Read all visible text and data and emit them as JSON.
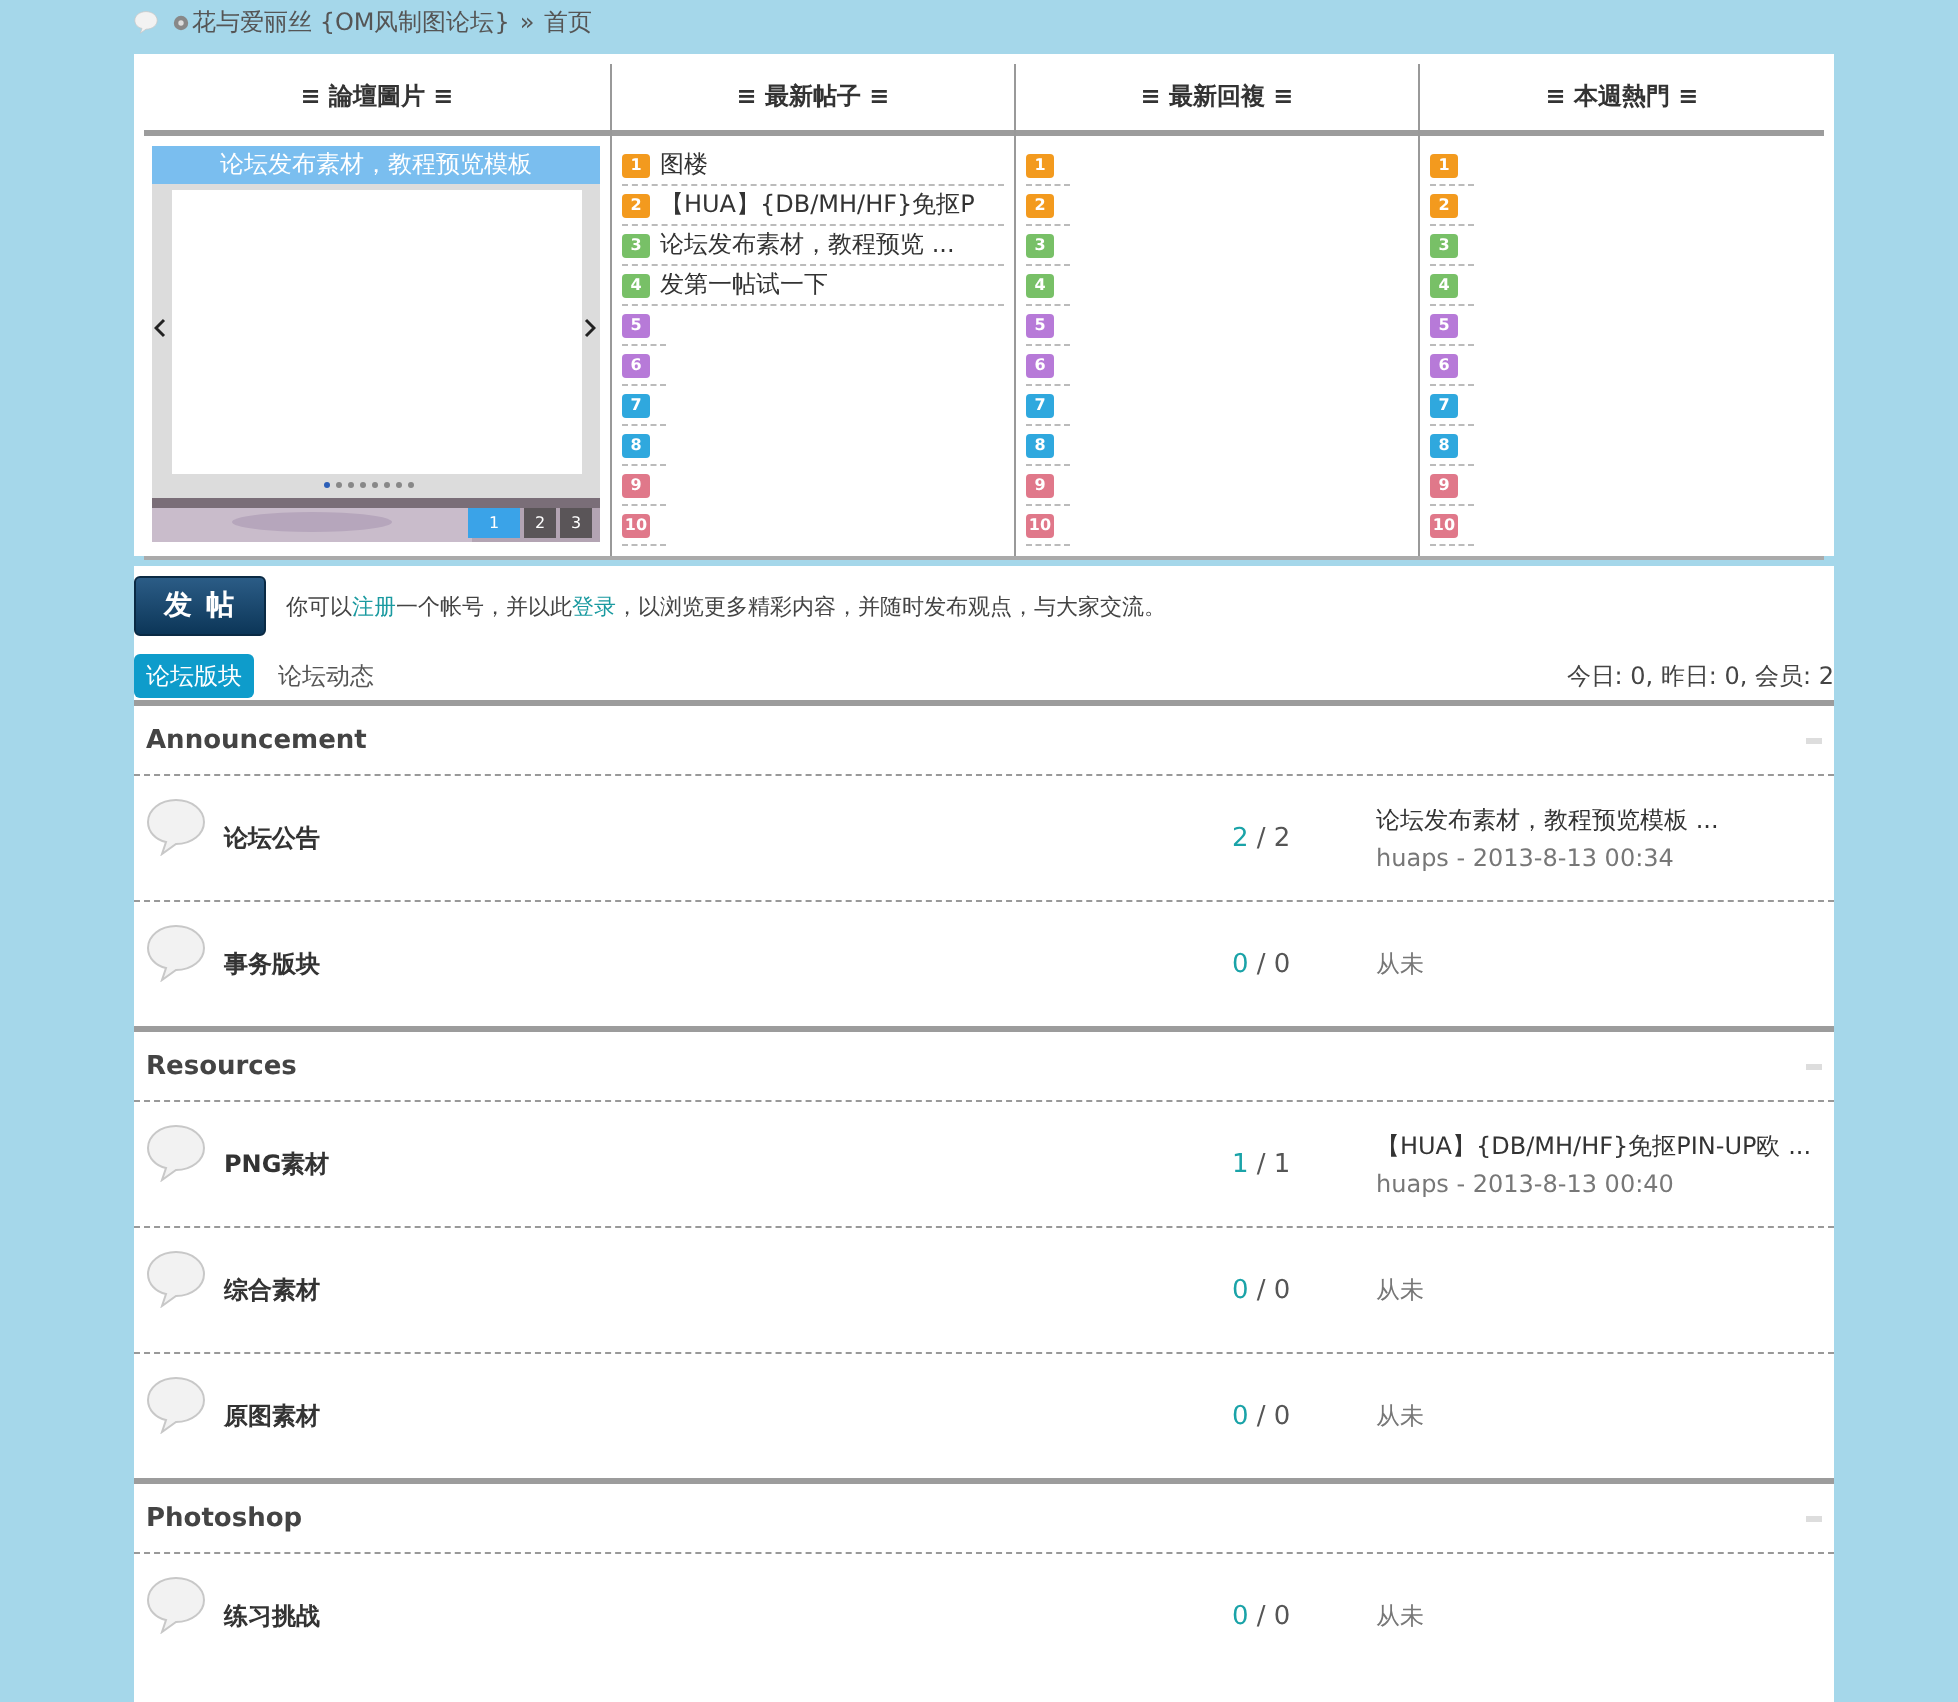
{
  "breadcrumb": {
    "site": "花与爱丽丝 {OM风制图论坛}",
    "separator": "»",
    "current": "首页"
  },
  "portal": {
    "columns": [
      {
        "kind": "slideshow",
        "header": "≡ 論壇圖片 ≡",
        "caption": "论坛发布素材，教程预览模板",
        "dots": [
          {
            "selected": true
          },
          {
            "selected": false
          },
          {
            "selected": false
          },
          {
            "selected": false
          },
          {
            "selected": false
          },
          {
            "selected": false
          },
          {
            "selected": false
          },
          {
            "selected": false
          }
        ],
        "pages": [
          {
            "label": "1",
            "selected": true
          },
          {
            "label": "2",
            "selected": false
          },
          {
            "label": "3",
            "selected": false
          }
        ]
      },
      {
        "kind": "list",
        "header": "≡ 最新帖子 ≡",
        "items": [
          {
            "rank": "1",
            "color": "#f39a1e",
            "title": "图楼"
          },
          {
            "rank": "2",
            "color": "#f39a1e",
            "title": "【HUA】{DB/MH/HF}免抠P"
          },
          {
            "rank": "3",
            "color": "#78c067",
            "title": "论坛发布素材，教程预览 ..."
          },
          {
            "rank": "4",
            "color": "#78c067",
            "title": "发第一帖试一下"
          },
          {
            "rank": "5",
            "color": "#b77ad8"
          },
          {
            "rank": "6",
            "color": "#b77ad8"
          },
          {
            "rank": "7",
            "color": "#2fa8de"
          },
          {
            "rank": "8",
            "color": "#2fa8de"
          },
          {
            "rank": "9",
            "color": "#e0788a"
          },
          {
            "rank": "10",
            "color": "#e0788a"
          }
        ]
      },
      {
        "kind": "list",
        "header": "≡ 最新回複 ≡",
        "items": [
          {
            "rank": "1",
            "color": "#f39a1e"
          },
          {
            "rank": "2",
            "color": "#f39a1e"
          },
          {
            "rank": "3",
            "color": "#78c067"
          },
          {
            "rank": "4",
            "color": "#78c067"
          },
          {
            "rank": "5",
            "color": "#b77ad8"
          },
          {
            "rank": "6",
            "color": "#b77ad8"
          },
          {
            "rank": "7",
            "color": "#2fa8de"
          },
          {
            "rank": "8",
            "color": "#2fa8de"
          },
          {
            "rank": "9",
            "color": "#e0788a"
          },
          {
            "rank": "10",
            "color": "#e0788a"
          }
        ]
      },
      {
        "kind": "list",
        "header": "≡ 本週熱門 ≡",
        "items": [
          {
            "rank": "1",
            "color": "#f39a1e"
          },
          {
            "rank": "2",
            "color": "#f39a1e"
          },
          {
            "rank": "3",
            "color": "#78c067"
          },
          {
            "rank": "4",
            "color": "#78c067"
          },
          {
            "rank": "5",
            "color": "#b77ad8"
          },
          {
            "rank": "6",
            "color": "#b77ad8"
          },
          {
            "rank": "7",
            "color": "#2fa8de"
          },
          {
            "rank": "8",
            "color": "#2fa8de"
          },
          {
            "rank": "9",
            "color": "#e0788a"
          },
          {
            "rank": "10",
            "color": "#e0788a"
          }
        ]
      }
    ]
  },
  "post_button": "发 帖",
  "notice": [
    {
      "kind": "text",
      "text": "你可以"
    },
    {
      "kind": "link",
      "text": "注册"
    },
    {
      "kind": "text",
      "text": "一个帐号，并以此"
    },
    {
      "kind": "link",
      "text": "登录"
    },
    {
      "kind": "text",
      "text": "，以浏览更多精彩内容，并随时发布观点，与大家交流。"
    }
  ],
  "tabs": [
    {
      "label": "论坛版块",
      "selected": true
    },
    {
      "label": "论坛动态",
      "selected": false
    }
  ],
  "stats": "今日: 0, 昨日: 0, 会员: 2",
  "categories": [
    {
      "title": "Announcement",
      "forums": [
        {
          "name": "论坛公告",
          "topics": "2",
          "separator": "/",
          "posts": "2",
          "last": {
            "kind": "post",
            "title": "论坛发布素材，教程预览模板 ...",
            "byline": "huaps - 2013-8-13 00:34"
          }
        },
        {
          "name": "事务版块",
          "topics": "0",
          "separator": "/",
          "posts": "0",
          "last": {
            "kind": "never",
            "text": "从未"
          }
        }
      ]
    },
    {
      "title": "Resources",
      "forums": [
        {
          "name": "PNG素材",
          "topics": "1",
          "separator": "/",
          "posts": "1",
          "last": {
            "kind": "post",
            "title": "【HUA】{DB/MH/HF}免抠PIN-UP欧 ...",
            "byline": "huaps - 2013-8-13 00:40"
          }
        },
        {
          "name": "综合素材",
          "topics": "0",
          "separator": "/",
          "posts": "0",
          "last": {
            "kind": "never",
            "text": "从未"
          }
        },
        {
          "name": "原图素材",
          "topics": "0",
          "separator": "/",
          "posts": "0",
          "last": {
            "kind": "never",
            "text": "从未"
          }
        }
      ]
    },
    {
      "title": "Photoshop",
      "forums": [
        {
          "name": "练习挑战",
          "topics": "0",
          "separator": "/",
          "posts": "0",
          "last": {
            "kind": "never",
            "text": "从未"
          }
        }
      ]
    }
  ]
}
